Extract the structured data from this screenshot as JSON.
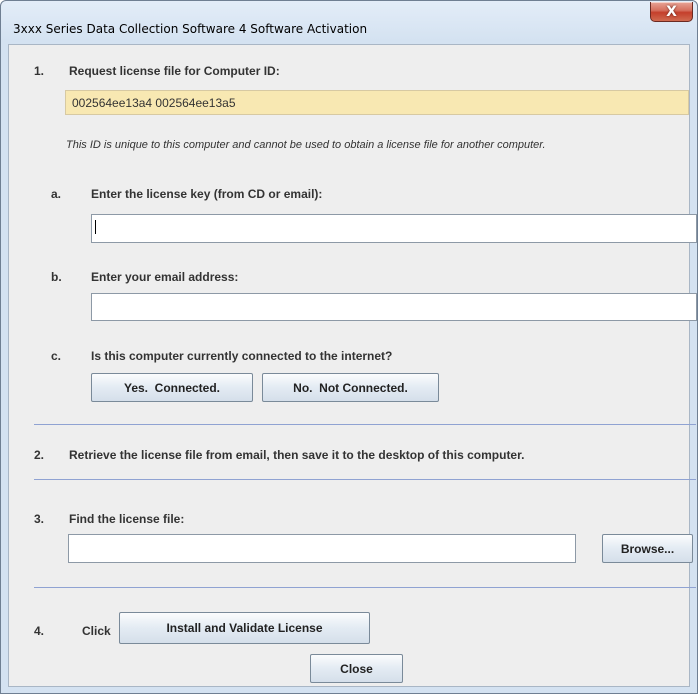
{
  "window": {
    "title": "3xxx Series Data Collection Software 4 Software Activation",
    "close_glyph": "X"
  },
  "step1": {
    "number": "1.",
    "heading": "Request license file for Computer ID:",
    "computer_id": "002564ee13a4 002564ee13a5",
    "note": "This ID is unique to this computer and cannot be used to obtain a license file for another computer.",
    "a": {
      "letter": "a.",
      "label": "Enter the license key (from CD or email):",
      "value": ""
    },
    "b": {
      "letter": "b.",
      "label": "Enter your email address:",
      "value": ""
    },
    "c": {
      "letter": "c.",
      "label": "Is this computer currently connected to the internet?",
      "yes_button": "Yes.  Connected.",
      "no_button": "No.  Not Connected."
    }
  },
  "step2": {
    "number": "2.",
    "text": "Retrieve the license file from email, then save it to the desktop of this computer."
  },
  "step3": {
    "number": "3.",
    "label": "Find the license file:",
    "value": "",
    "browse_button": "Browse..."
  },
  "step4": {
    "number": "4.",
    "click_label": "Click",
    "install_button": "Install and Validate License"
  },
  "footer": {
    "close_button": "Close"
  },
  "colors": {
    "id_background": "#f8e8b2",
    "separator": "#8fa2d2",
    "close_button_red": "#c43f2b"
  }
}
